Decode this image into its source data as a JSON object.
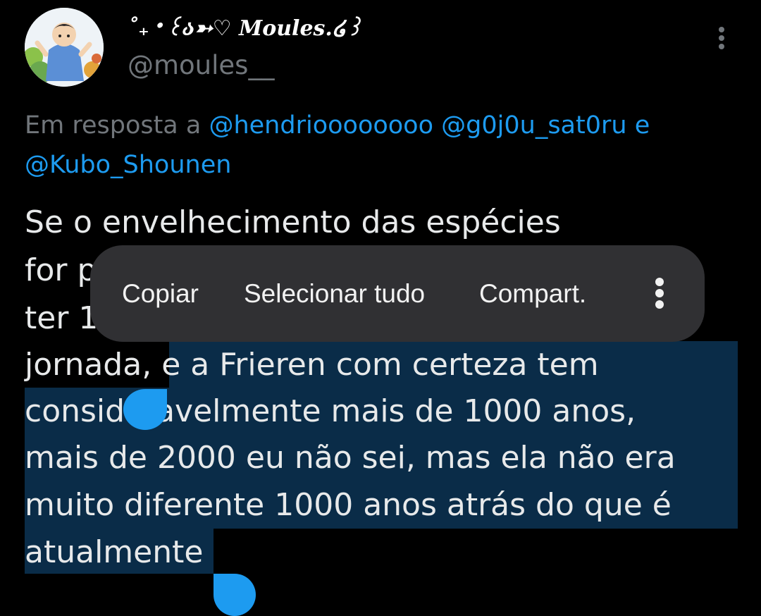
{
  "tweet": {
    "display_name": "˚₊‧꒰ა➳♡ 𝑴𝒐𝒖𝒍𝒆𝒔.໒꒱",
    "handle": "@moules__",
    "reply_prefix": "Em resposta a ",
    "reply_users": [
      "@hendrioooooooo",
      "@g0j0u_sat0ru",
      "@Kubo_Shounen"
    ],
    "reply_conjunction": " e",
    "text_lines": [
      "Se o envelhecimento das espécies",
      "for p",
      "ter 1",
      "jornada, ",
      "e a Frieren com certeza tem",
      "consid",
      "avelmente mais de 1000 anos,",
      "mais de 2000 eu não sei, mas ela não era",
      "muito diferente 1000 anos atrás do que é",
      "atualmente"
    ]
  },
  "selection_toolbar": {
    "copy_label": "Copiar",
    "select_all_label": "Selecionar tudo",
    "share_label": "Compart.",
    "more_icon": "vertical-ellipsis-icon"
  },
  "colors": {
    "background": "#000000",
    "text": "#e7e9ea",
    "secondary_text": "#71767b",
    "link": "#1d9bf0",
    "selection": "#0a2c48",
    "toolbar_bg": "#303033"
  }
}
